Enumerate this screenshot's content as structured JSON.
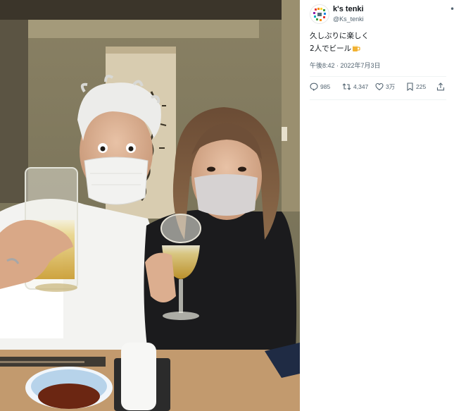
{
  "photo": {
    "alt": ""
  },
  "tweet": {
    "display_name": "k's tenki",
    "handle": "@Ks_tenki",
    "more_icon": "more-horizontal-icon",
    "text_line1": "久しぶりに楽しく",
    "text_line2": "2人でビール",
    "emoji_icon": "beer-mug-icon",
    "timestamp": "午後8:42 · 2022年7月3日",
    "actions": {
      "reply": {
        "icon": "reply-icon",
        "count": "985"
      },
      "retweet": {
        "icon": "retweet-icon",
        "count": "4,347"
      },
      "like": {
        "icon": "heart-icon",
        "count": "3万"
      },
      "bookmark": {
        "icon": "bookmark-icon",
        "count": "225"
      },
      "share": {
        "icon": "share-icon"
      }
    }
  },
  "colors": {
    "text": "#0f1419",
    "muted": "#536471",
    "divider": "#eff3f4"
  }
}
